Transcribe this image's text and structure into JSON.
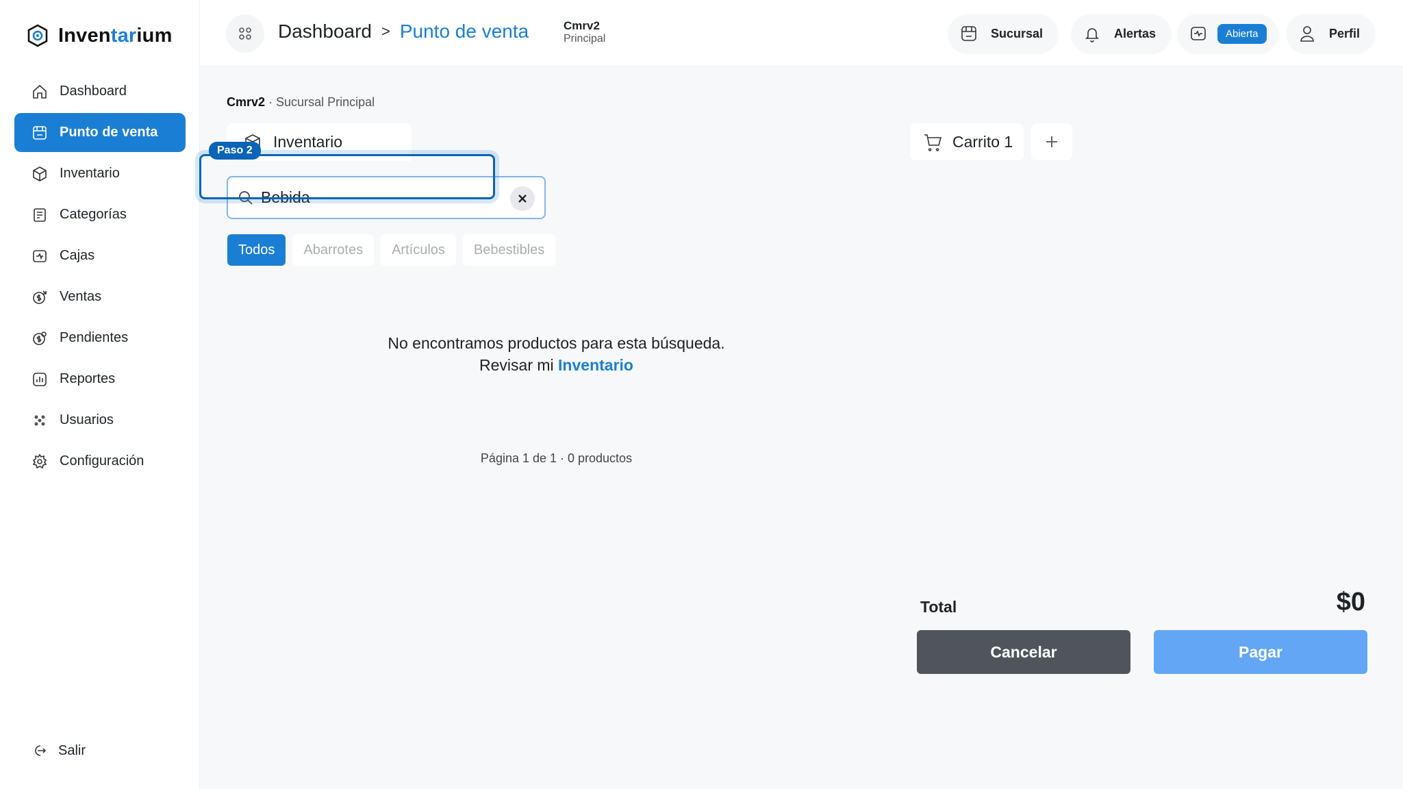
{
  "app": {
    "logo_part1": "Inven",
    "logo_part2": "tar",
    "logo_part3": "ium"
  },
  "sidebar": {
    "items": [
      {
        "label": "Dashboard",
        "icon": "home-icon"
      },
      {
        "label": "Punto de venta",
        "icon": "store-icon",
        "active": true
      },
      {
        "label": "Inventario",
        "icon": "box-icon"
      },
      {
        "label": "Categorías",
        "icon": "tag-icon"
      },
      {
        "label": "Cajas",
        "icon": "cash-register-icon"
      },
      {
        "label": "Ventas",
        "icon": "dollar-icon"
      },
      {
        "label": "Pendientes",
        "icon": "pending-dollar-icon"
      },
      {
        "label": "Reportes",
        "icon": "chart-icon"
      },
      {
        "label": "Usuarios",
        "icon": "users-icon"
      },
      {
        "label": "Configuración",
        "icon": "gear-icon"
      }
    ],
    "logout_label": "Salir"
  },
  "header": {
    "breadcrumb_root": "Dashboard",
    "breadcrumb_sep": ">",
    "breadcrumb_current": "Punto de venta",
    "company": "Cmrv2",
    "branch": "Principal",
    "sucursal_label": "Sucursal",
    "alertas_label": "Alertas",
    "caja_status": "Abierta",
    "perfil_label": "Perfil"
  },
  "main": {
    "company": "Cmrv2",
    "subtitle_rest": "· Sucursal Principal",
    "tab_label": "Inventario",
    "search_value": "Bebida",
    "tutorial_badge": "Paso 2",
    "filters": [
      "Todos",
      "Abarrotes",
      "Artículos",
      "Bebestibles"
    ],
    "empty_line1": "No encontramos productos para esta búsqueda.",
    "empty_line2_prefix": "Revisar mi",
    "empty_link": "Inventario",
    "pagination": "Página 1 de 1 · 0 productos"
  },
  "cart": {
    "tab_label": "Carrito 1",
    "total_label": "Total",
    "total_value": "$0",
    "cancel_label": "Cancelar",
    "pay_label": "Pagar"
  },
  "colors": {
    "accent": "#1a7fd4",
    "cancel": "#50555c",
    "pay": "#63a6f6"
  }
}
